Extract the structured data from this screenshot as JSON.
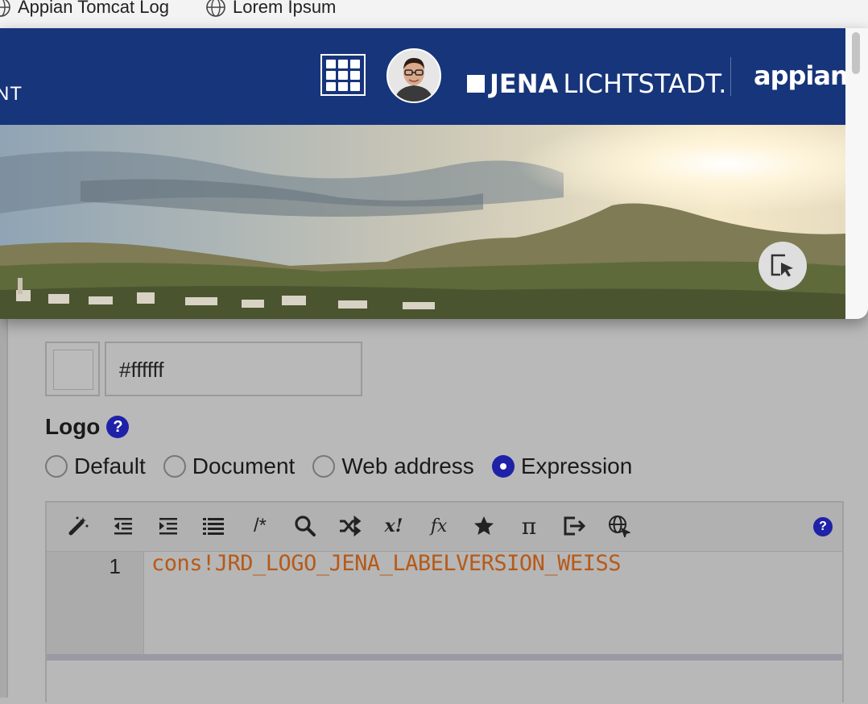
{
  "bookmarks": [
    {
      "label": "Appian Tomcat Log",
      "icon": "globe-icon"
    },
    {
      "label": "Lorem Ipsum",
      "icon": "globe-icon"
    }
  ],
  "header": {
    "left_text": "NT",
    "logo_left": "JENA",
    "logo_right": "LICHTSTADT.",
    "brand": "appian",
    "bg_color": "#17357a"
  },
  "form": {
    "color_value": "#ffffff",
    "logo_label": "Logo",
    "help_glyph": "?",
    "radio_options": [
      "Default",
      "Document",
      "Web address",
      "Expression"
    ],
    "selected_option": "Expression",
    "accent_color": "#1f21a8"
  },
  "editor": {
    "toolbar_icons": [
      "magic-wand-icon",
      "outdent-icon",
      "indent-icon",
      "format-icon",
      "comment-icon",
      "search-icon",
      "shuffle-icon",
      "variable-icon",
      "function-icon",
      "star-icon",
      "pi-icon",
      "export-icon",
      "globe-icon",
      "help-icon"
    ],
    "comment_glyph": "/*",
    "variable_glyph": "x!",
    "function_glyph": "fx",
    "pi_glyph": "π",
    "line_number": "1",
    "code": "cons!JRD_LOGO_JENA_LABELVERSION_WEISS",
    "code_color": "#b65a18"
  }
}
